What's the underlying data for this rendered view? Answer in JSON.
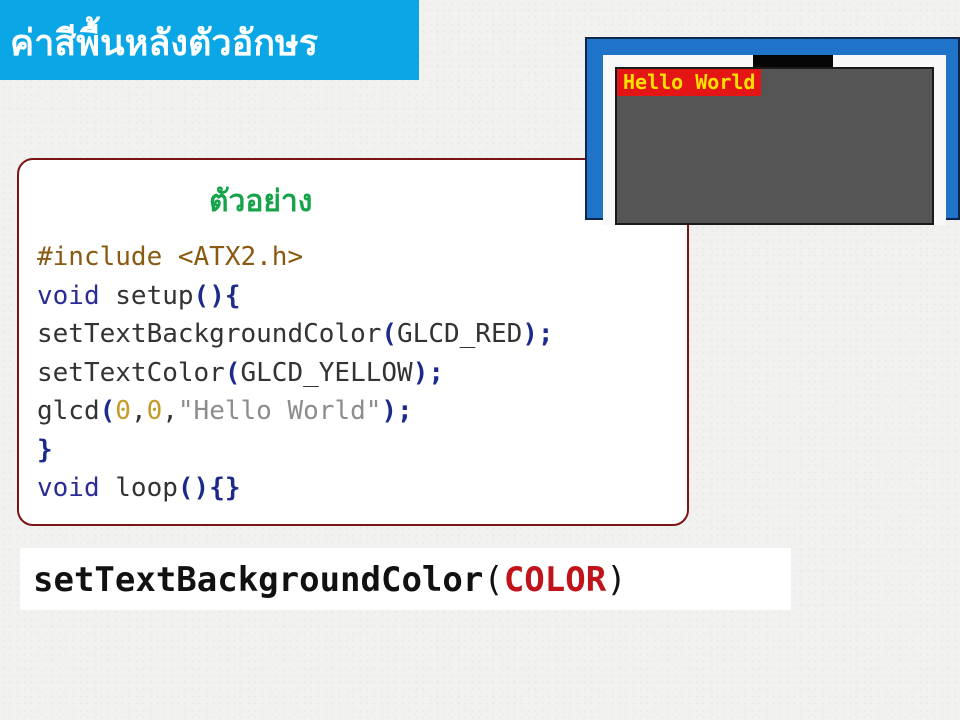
{
  "header": {
    "title": "ค่าสีพื้นหลังตัวอักษร",
    "color": "#0aa6e6"
  },
  "example": {
    "title": "ตัวอย่าง",
    "code_lines": [
      [
        {
          "t": "#include <ATX2.h>",
          "c": "pp"
        }
      ],
      [
        {
          "t": "void",
          "c": "kw"
        },
        {
          "t": " setup",
          "c": "fn"
        },
        {
          "t": "(){",
          "c": "br"
        }
      ],
      [
        {
          "t": "setTextBackgroundColor",
          "c": "fn"
        },
        {
          "t": "(",
          "c": "br"
        },
        {
          "t": "GLCD_RED",
          "c": "plain"
        },
        {
          "t": ");",
          "c": "br"
        }
      ],
      [
        {
          "t": "setTextColor",
          "c": "fn"
        },
        {
          "t": "(",
          "c": "br"
        },
        {
          "t": "GLCD_YELLOW",
          "c": "plain"
        },
        {
          "t": ");",
          "c": "br"
        }
      ],
      [
        {
          "t": "glcd",
          "c": "fn"
        },
        {
          "t": "(",
          "c": "br"
        },
        {
          "t": "0",
          "c": "num"
        },
        {
          "t": ",",
          "c": "plain"
        },
        {
          "t": "0",
          "c": "num"
        },
        {
          "t": ",",
          "c": "plain"
        },
        {
          "t": "\"Hello World\"",
          "c": "str"
        },
        {
          "t": ");",
          "c": "br"
        }
      ],
      [
        {
          "t": "}",
          "c": "br"
        }
      ],
      [
        {
          "t": "void",
          "c": "kw"
        },
        {
          "t": " loop",
          "c": "fn"
        },
        {
          "t": "(){}",
          "c": "br"
        }
      ]
    ]
  },
  "lcd_preview": {
    "text": "Hello World",
    "text_color": "#ffe100",
    "background_color": "#e31515",
    "screen_color": "#555555"
  },
  "syntax": {
    "function": "setTextBackgroundColor",
    "open": "(",
    "argument": "COLOR",
    "close": ")"
  }
}
